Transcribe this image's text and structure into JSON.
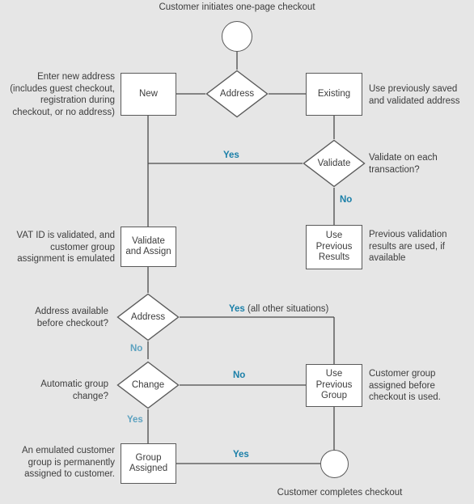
{
  "diagram": {
    "title": "Customer initiates one-page checkout",
    "footer": "Customer completes checkout",
    "colors": {
      "background": "#e6e6e6",
      "node_fill": "#ffffff",
      "node_stroke": "#5a5a5a",
      "text": "#3d3d3d",
      "edge_label": "#1a7fa8",
      "edge_label_muted": "#5da2c0"
    },
    "nodes": {
      "start": "",
      "address_1": "Address",
      "new": "New",
      "existing": "Existing",
      "validate": "Validate",
      "validate_and_assign": "Validate\nand Assign",
      "validate_and_assign_line1": "Validate",
      "validate_and_assign_line2": "and Assign",
      "use_previous_results_line1": "Use",
      "use_previous_results_line2": "Previous",
      "use_previous_results_line3": "Results",
      "address_2": "Address",
      "change": "Change",
      "use_previous_group_line1": "Use",
      "use_previous_group_line2": "Previous",
      "use_previous_group_line3": "Group",
      "group_assigned_line1": "Group",
      "group_assigned_line2": "Assigned",
      "end": ""
    },
    "notes": {
      "new_note": "Enter new address (includes guest checkout, registration during checkout, or no address)",
      "existing_note": "Use previously saved and validated address",
      "validate_note": "Validate on each transaction?",
      "validate_assign_note": "VAT ID is validated, and customer group assignment is emulated",
      "previous_results_note": "Previous validation results are used, if available",
      "address2_note": "Address available before checkout?",
      "change_note": "Automatic group change?",
      "previous_group_note": "Customer group assigned before checkout is used.",
      "group_assigned_note": "An emulated customer group is permanently assigned to customer."
    },
    "edge_labels": {
      "validate_yes": "Yes",
      "validate_no": "No",
      "address2_yes": "Yes",
      "address2_yes_suffix": " (all other situations)",
      "address2_no": "No",
      "change_no": "No",
      "change_yes": "Yes",
      "group_assigned_yes": "Yes"
    }
  }
}
